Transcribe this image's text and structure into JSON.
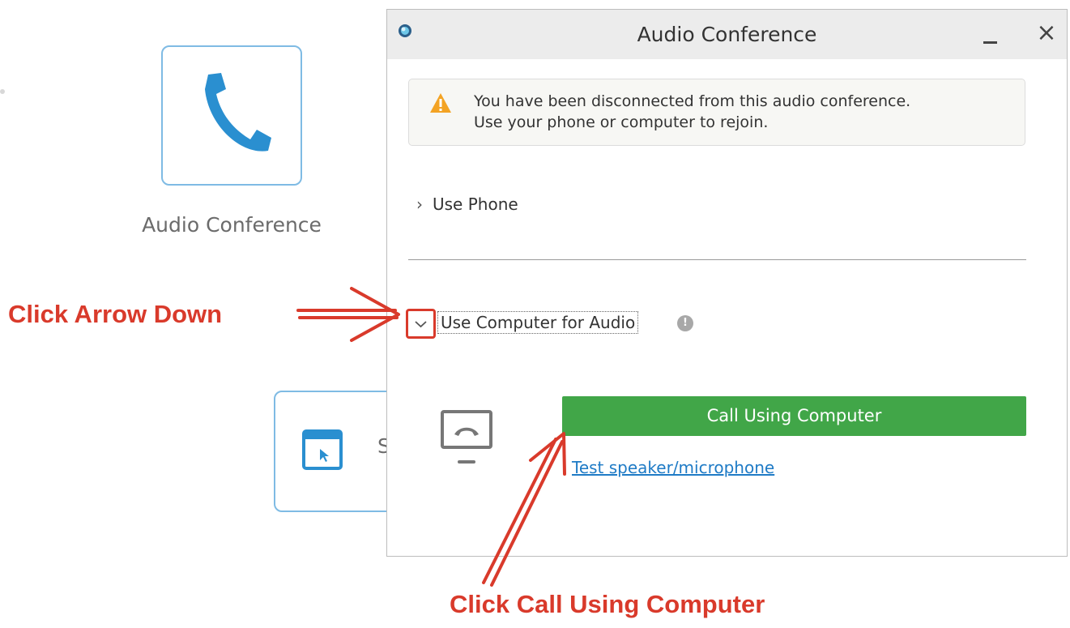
{
  "background": {
    "audio_tile_label": "Audio Conference",
    "share_tile_partial_text": "S"
  },
  "dialog": {
    "title": "Audio Conference",
    "minimize_label": "_",
    "close_label": "×",
    "alert": {
      "line1": "You have been disconnected from this audio conference.",
      "line2": "Use your phone or computer to rejoin."
    },
    "use_phone_label": "Use Phone",
    "use_computer_label": "Use Computer for Audio",
    "info_label": "!",
    "call_button_label": "Call Using Computer",
    "test_link_label": "Test speaker/microphone"
  },
  "annotations": {
    "arrow_down": "Click Arrow Down",
    "call_using_computer": "Click Call Using Computer"
  },
  "colors": {
    "annotation": "#d93a2b",
    "call_button": "#41a648",
    "link": "#1f7bc6",
    "tile_border": "#7fbbe4"
  }
}
